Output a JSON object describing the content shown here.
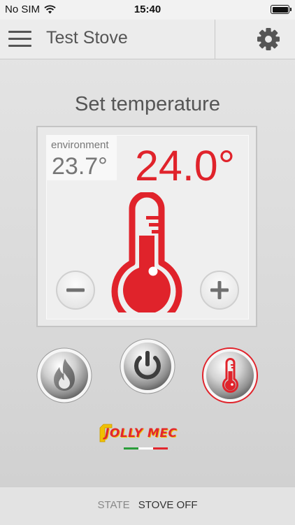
{
  "status_bar": {
    "carrier": "No SIM",
    "time": "15:40",
    "wifi_icon": "wifi-icon",
    "battery_icon": "battery-icon"
  },
  "header": {
    "menu_icon": "hamburger-menu-icon",
    "title": "Test Stove",
    "settings_icon": "gear-icon"
  },
  "main": {
    "title": "Set temperature",
    "environment": {
      "label": "environment",
      "value": "23.7°"
    },
    "set_temperature": "24.0°",
    "thermometer_icon": "thermometer-icon",
    "minus_icon": "minus-icon",
    "plus_icon": "plus-icon"
  },
  "modes": [
    {
      "icon": "flame-icon",
      "active": false
    },
    {
      "icon": "power-icon",
      "active": false
    },
    {
      "icon": "thermometer-icon",
      "active": true
    }
  ],
  "logo": {
    "text": "JOLLY MEC"
  },
  "state": {
    "label": "STATE",
    "value": "STOVE OFF"
  },
  "colors": {
    "accent_red": "#e0232b",
    "text_gray": "#555555",
    "logo_yellow": "#f0c000",
    "flag_green": "#2a9d3a",
    "flag_white": "#ffffff",
    "flag_red": "#e2262d"
  }
}
